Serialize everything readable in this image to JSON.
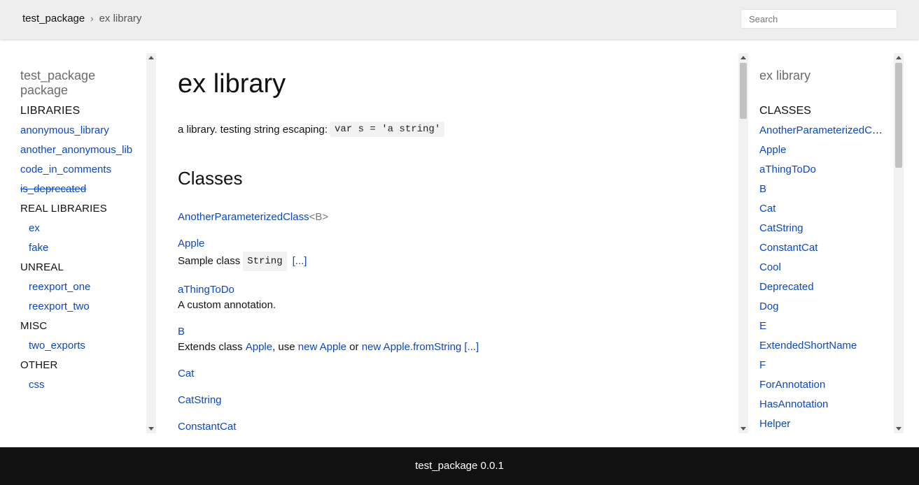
{
  "header": {
    "breadcrumb": {
      "root": "test_package",
      "separator": "›",
      "current": "ex library"
    },
    "search_placeholder": "Search"
  },
  "left_sidebar": {
    "title": "test_package package",
    "items": [
      {
        "type": "section",
        "label": "LIBRARIES"
      },
      {
        "type": "link",
        "label": "anonymous_library"
      },
      {
        "type": "link",
        "label": "another_anonymous_lib"
      },
      {
        "type": "link",
        "label": "code_in_comments"
      },
      {
        "type": "link",
        "label": "is_deprecated",
        "deprecated": true
      },
      {
        "type": "section",
        "label": "REAL LIBRARIES"
      },
      {
        "type": "sub",
        "label": "ex"
      },
      {
        "type": "sub",
        "label": "fake"
      },
      {
        "type": "section",
        "label": "UNREAL"
      },
      {
        "type": "sub",
        "label": "reexport_one"
      },
      {
        "type": "sub",
        "label": "reexport_two"
      },
      {
        "type": "section",
        "label": "MISC"
      },
      {
        "type": "sub",
        "label": "two_exports"
      },
      {
        "type": "section",
        "label": "OTHER"
      },
      {
        "type": "sub",
        "label": "css"
      }
    ]
  },
  "main": {
    "title": "ex library",
    "description": {
      "text": "a library. testing string escaping:",
      "code": "var s = 'a string'"
    },
    "classes_heading": "Classes",
    "classes": [
      {
        "name": "AnotherParameterizedClass",
        "generic": "<B>"
      },
      {
        "name": "Apple",
        "desc_text": "Sample class",
        "desc_code": "String",
        "more": "[...]"
      },
      {
        "name": "aThingToDo",
        "desc_text": "A custom annotation."
      },
      {
        "name": "B",
        "desc_text": "Extends class",
        "links": [
          "Apple",
          "new Apple",
          "new Apple.fromString"
        ],
        "mid1": ", use",
        "mid2": "or",
        "more": "[...]"
      },
      {
        "name": "Cat"
      },
      {
        "name": "CatString"
      },
      {
        "name": "ConstantCat"
      }
    ]
  },
  "right_sidebar": {
    "title": "ex library",
    "section": "CLASSES",
    "items": [
      "AnotherParameterizedClass",
      "Apple",
      "aThingToDo",
      "B",
      "Cat",
      "CatString",
      "ConstantCat",
      "Cool",
      "Deprecated",
      "Dog",
      "E",
      "ExtendedShortName",
      "F",
      "ForAnnotation",
      "HasAnnotation",
      "Helper"
    ]
  },
  "footer": {
    "text": "test_package 0.0.1"
  }
}
